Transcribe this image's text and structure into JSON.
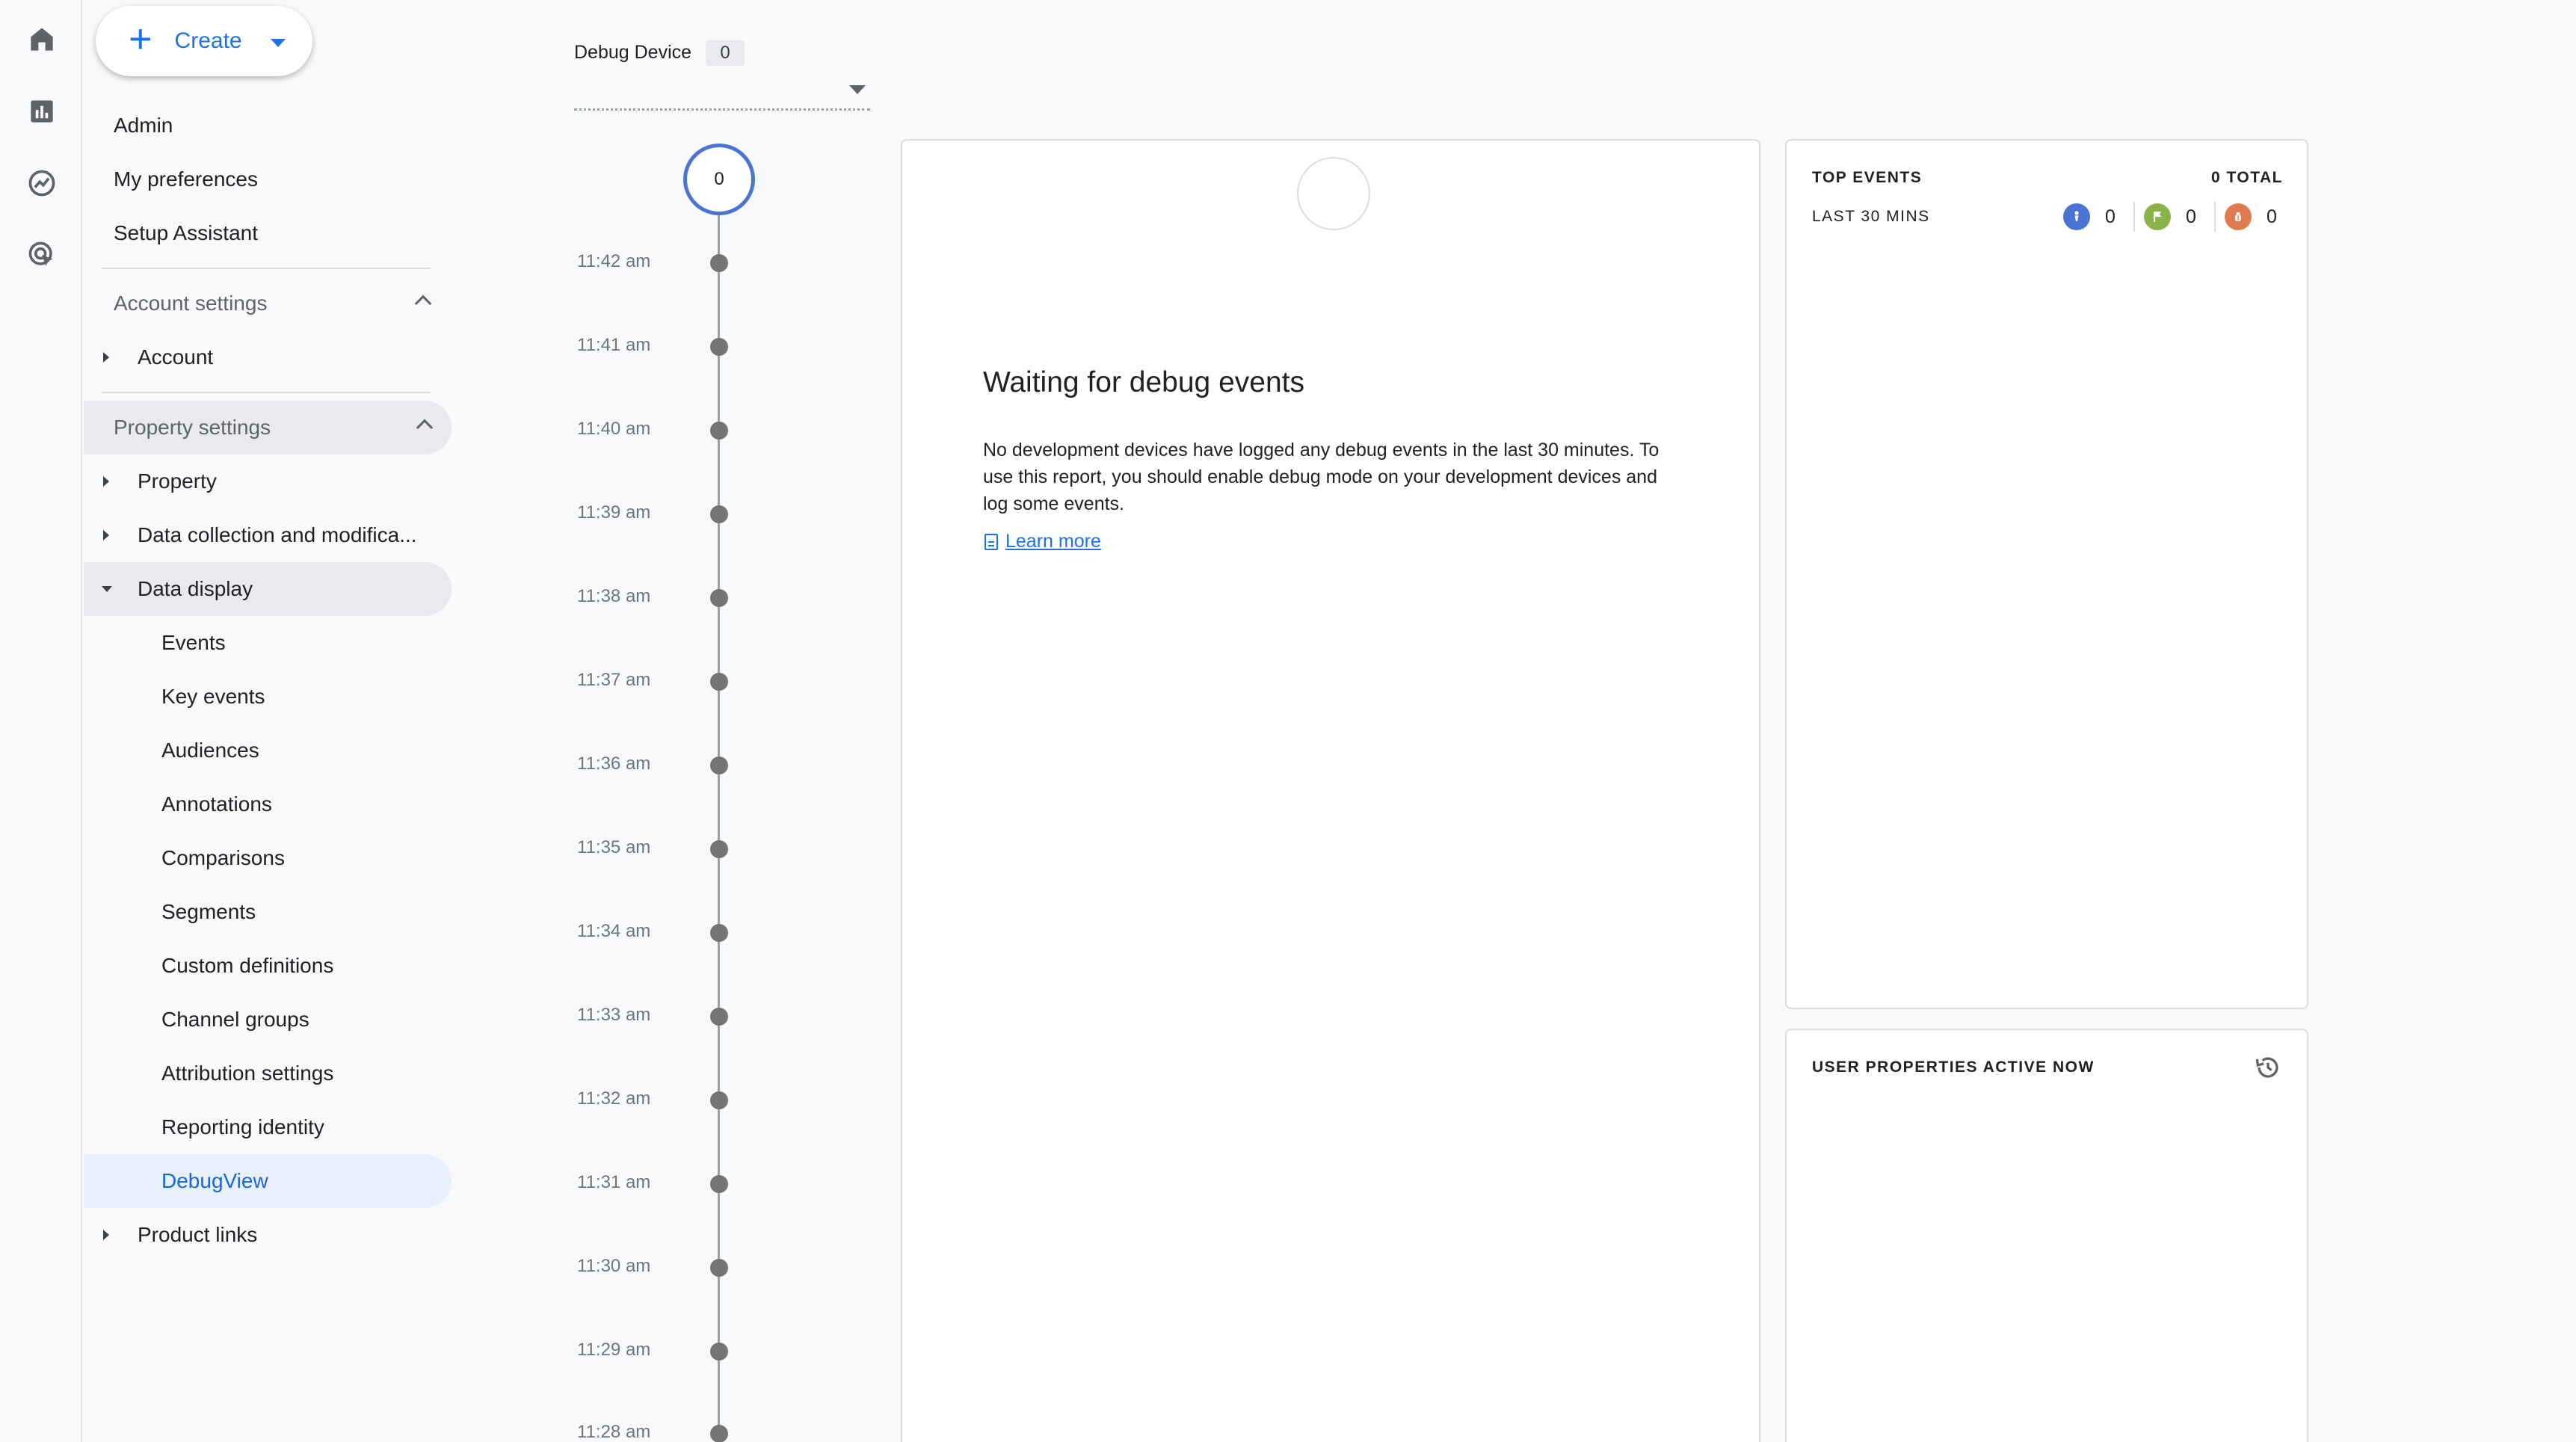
{
  "create": {
    "label": "Create"
  },
  "sidebar": {
    "admin": "Admin",
    "my_preferences": "My preferences",
    "setup_assistant": "Setup Assistant",
    "account_settings": "Account settings",
    "account": "Account",
    "property_settings": "Property settings",
    "property": "Property",
    "data_collection": "Data collection and modifica...",
    "data_display": "Data display",
    "sub": [
      "Events",
      "Key events",
      "Audiences",
      "Annotations",
      "Comparisons",
      "Segments",
      "Custom definitions",
      "Channel groups",
      "Attribution settings",
      "Reporting identity",
      "DebugView"
    ],
    "product_links": "Product links"
  },
  "debug": {
    "device_label": "Debug Device",
    "device_count": "0",
    "current_count": "0",
    "times": [
      "11:42 am",
      "11:41 am",
      "11:40 am",
      "11:39 am",
      "11:38 am",
      "11:37 am",
      "11:36 am",
      "11:35 am",
      "11:34 am",
      "11:33 am",
      "11:32 am",
      "11:31 am",
      "11:30 am",
      "11:29 am",
      "11:28 am"
    ]
  },
  "center": {
    "title": "Waiting for debug events",
    "description": "No development devices have logged any debug events in the last 30 minutes. To use this report, you should enable debug mode on your development devices and log some events.",
    "learn_more": "Learn more"
  },
  "top_events": {
    "header": "TOP EVENTS",
    "total": "0 TOTAL",
    "period": "LAST 30 MINS",
    "events_count": "0",
    "key_events_count": "0",
    "errors_count": "0",
    "colors": {
      "events": "#4a73d3",
      "key_events": "#8ab34a",
      "errors": "#e07a4f"
    }
  },
  "user_properties": {
    "header": "USER PROPERTIES ACTIVE NOW"
  }
}
